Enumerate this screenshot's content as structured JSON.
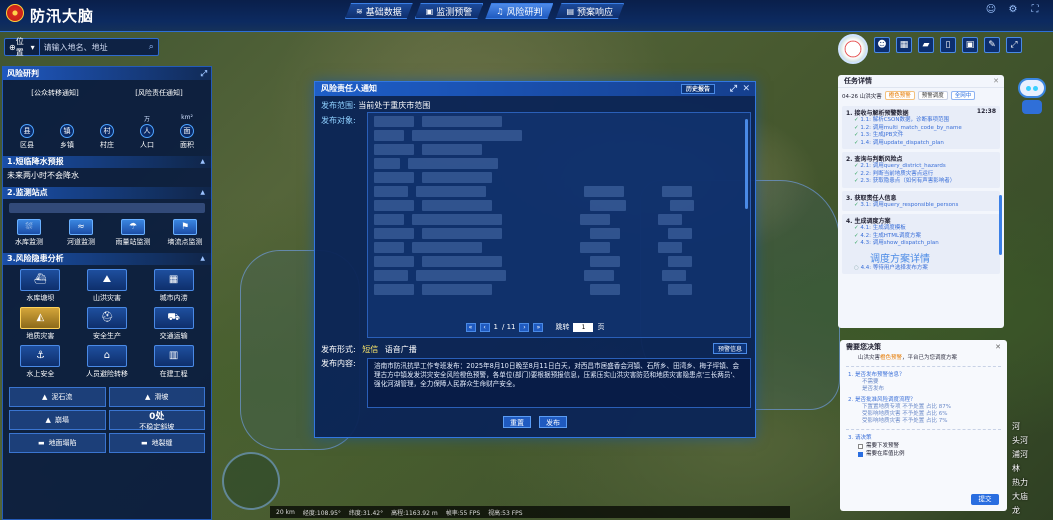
{
  "header": {
    "title": "防汛大脑",
    "tabs": [
      {
        "label": "基础数据",
        "icon": "layers-icon"
      },
      {
        "label": "监测预警",
        "icon": "monitor-icon"
      },
      {
        "label": "风险研判",
        "icon": "bell-icon"
      },
      {
        "label": "预案响应",
        "icon": "file-icon"
      }
    ],
    "active_tab": "风险研判"
  },
  "search": {
    "location_label": "位置",
    "placeholder": "请输入地名、地址"
  },
  "left_panel": {
    "title": "风险研判",
    "subtabs": [
      "[公众转移通知]",
      "[风险责任通知]"
    ],
    "units": [
      "",
      "",
      "",
      "万",
      "km²"
    ],
    "stats": [
      {
        "badge": "县",
        "label": "区县"
      },
      {
        "badge": "镇",
        "label": "乡镇"
      },
      {
        "badge": "村",
        "label": "村庄"
      },
      {
        "badge": "人",
        "label": "人口"
      },
      {
        "badge": "面",
        "label": "面积"
      }
    ],
    "s1_title": "1.短临降水预报",
    "s1_text": "未来两小时不会降水",
    "s2_title": "2.监测站点",
    "stations": [
      "水库监测",
      "河道监测",
      "雨量站监测",
      "墒流点监测"
    ],
    "s3_title": "3.风险隐患分析",
    "risks": [
      "水库塘坝",
      "山洪灾害",
      "城市内涝",
      "地质灾害",
      "安全生产",
      "交通运输",
      "水上安全",
      "人员避险转移",
      "在建工程"
    ],
    "risk_active": "地质灾害",
    "options": [
      {
        "label": "泥石流",
        "value": ""
      },
      {
        "label": "滑坡",
        "value": ""
      },
      {
        "label": "崩塌",
        "value": ""
      },
      {
        "label": "不稳定斜坡",
        "value": "0处"
      },
      {
        "label": "地面塌陷",
        "value": ""
      },
      {
        "label": "地裂缝",
        "value": ""
      }
    ]
  },
  "modal": {
    "title": "风险责任人通知",
    "history_btn": "历史报告",
    "range_label": "发布范围:",
    "range_value": "当前处于重庆市范围",
    "target_label": "发布对象:",
    "page_current": "1",
    "page_total": "/ 11",
    "jump_label": "跳转",
    "jump_value": "1",
    "jump_unit": "页",
    "form_label": "发布形式:",
    "form_sms": "短信",
    "form_broadcast": "语音广播",
    "warn_btn": "预警信息",
    "content_label": "发布内容:",
    "content": "涪南市防汛抗旱工作专班发布：2025年8月10日晚至8月11日白天，对西昌市居盛香会河镇、石所乡、田湾乡、梅子坪镇、会理古方中镇发发洪灾安全风险橙色预警，各单位(部门)要根据预报信息，压紧压实山洪灾害防范和地质灾害隐患点'三长两员'、强化河湖管理，全力保障人民群众生命财产安全。",
    "cancel_btn": "重置",
    "publish_btn": "发布"
  },
  "task_panel": {
    "title": "任务详情",
    "chips": [
      "04-26 山洪灾害",
      "橙色预警",
      "预警调度",
      "全网中"
    ],
    "steps": [
      {
        "title": "1. 接收与解析预警数据",
        "time": "12:38",
        "subs": [
          "1.1: 解析CSON数据，诊断事项范围",
          "1.2: 调用multi_match_code_by_name",
          "1.3: 生成JPB文件",
          "1.4: 调用update_dispatch_plan"
        ]
      },
      {
        "title": "2. 查询与判断风险点",
        "time": "",
        "subs": [
          "2.1: 调用query_district_hazards",
          "2.2: 判断当前地质灾害点运行",
          "2.3: 获取隐患点（如何有声害影响者）"
        ]
      },
      {
        "title": "3. 获取责任人信息",
        "time": "",
        "subs": [
          "3.1: 调用query_responsible_persons"
        ]
      },
      {
        "title": "4. 生成调度方案",
        "time": "",
        "subs": [
          "4.1: 生成调度模板",
          "4.2: 生成HTML调度方案",
          "4.3: 调用show_dispatch_plan"
        ]
      }
    ],
    "big_link": "调度方案详情",
    "footer": "4.4: 等待用户选择发布方案"
  },
  "decision_panel": {
    "title": "需要您决策",
    "intro_a": "山洪灾害",
    "intro_hl": "橙色预警",
    "intro_b": "，平台已为您调度方案",
    "q1": "1. 是否发布预警信息？",
    "q1_opts": [
      "不需要",
      "是否发布"
    ],
    "q2": "2. 是否批准风险调度流程？",
    "q2_opts": [
      "下置置地质专项 不予处置 占比 87%",
      "受影响地质灾害 不予处置 占比 6%",
      "受影响地质灾害 不予处置 占比 7%"
    ],
    "q3": "3. 请决策",
    "q3_opts": [
      "需要下发预警",
      "需要在库值比例"
    ],
    "submit": "提交"
  },
  "right_edge": [
    "河",
    "头河",
    "浦河",
    "林",
    "热力",
    "大庙",
    "龙"
  ],
  "status_bar": [
    "20 km",
    "经度:108.95°",
    "纬度:31.42°",
    "高程:1163.92 m",
    "帧率:55 FPS",
    "视高:53 FPS"
  ]
}
